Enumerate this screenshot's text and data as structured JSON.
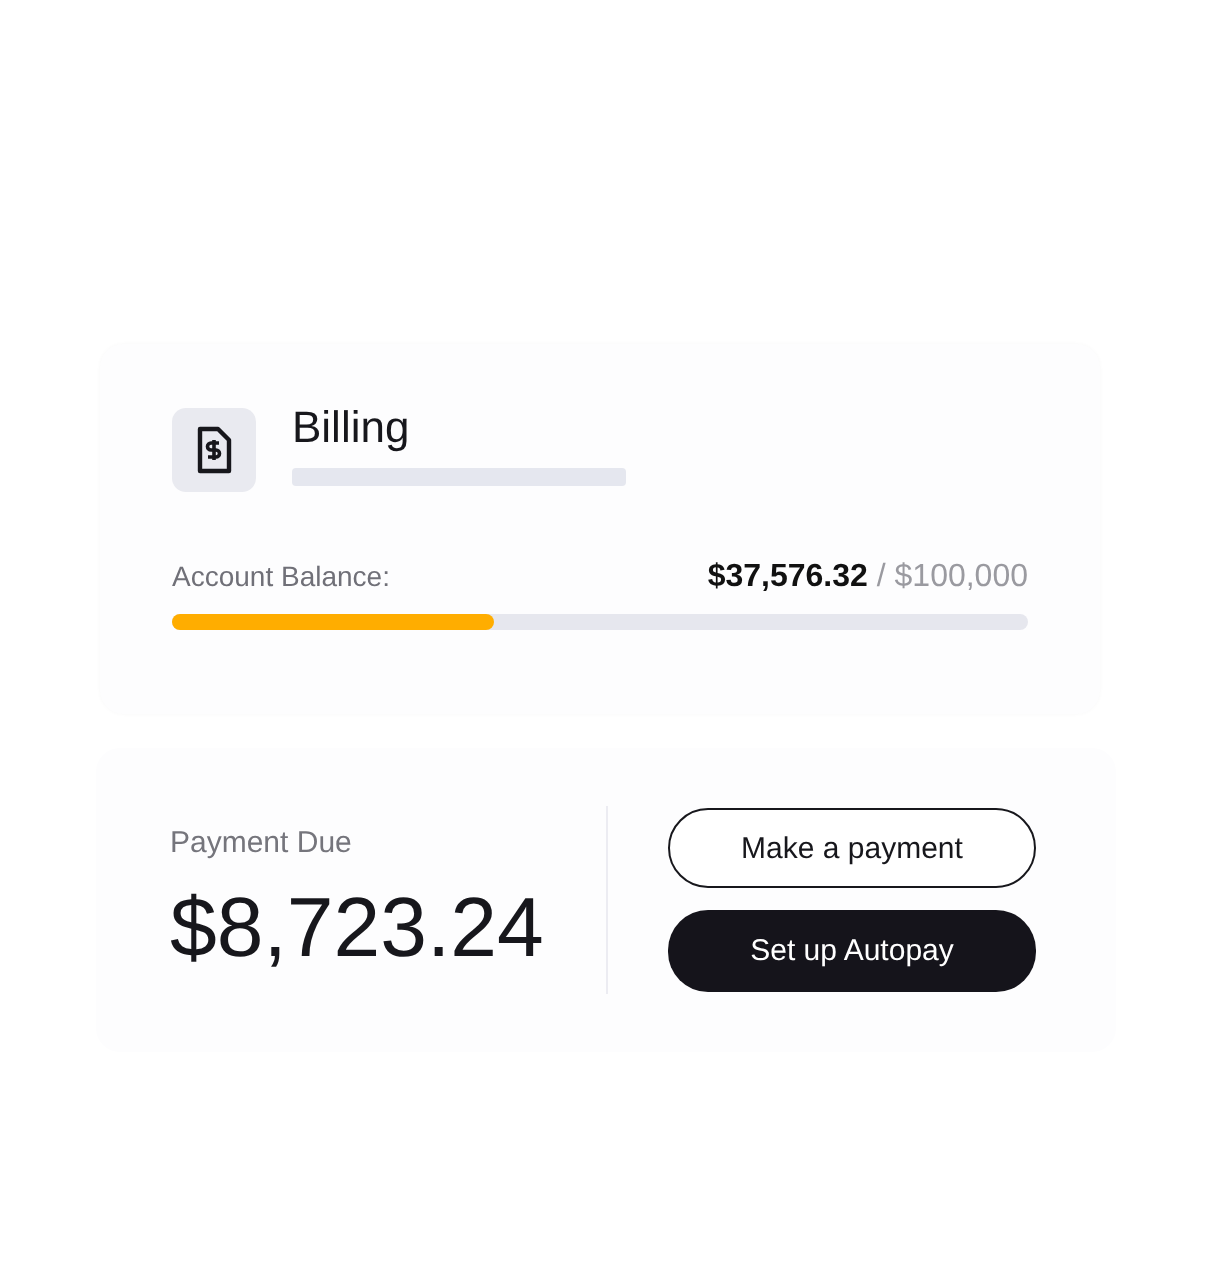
{
  "billing": {
    "title": "Billing",
    "balance_label": "Account Balance:",
    "balance": "$37,576.32",
    "separator": "/",
    "limit": "$100,000",
    "level": 0.376
  },
  "payment": {
    "label": "Payment Due",
    "amount": "$8,723.24",
    "buttons": [
      {
        "label": "Make a payment",
        "kind": "outline"
      },
      {
        "label": "Set up Autopay",
        "kind": "filled"
      }
    ]
  }
}
